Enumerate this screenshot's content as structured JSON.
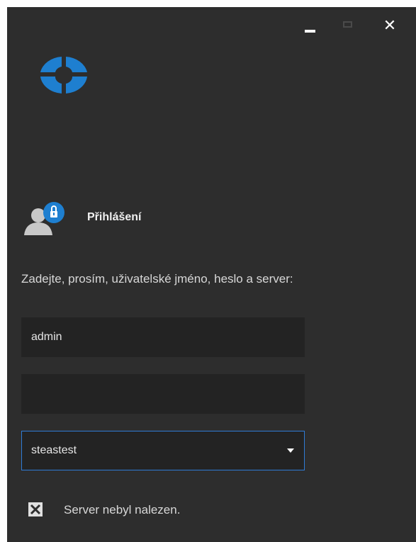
{
  "window": {
    "controls": {
      "close_glyph": "✕"
    }
  },
  "login": {
    "title": "Přihlášení",
    "instructions": "Zadejte, prosím, uživatelské jméno, heslo a server:",
    "username_value": "admin",
    "password_value": "",
    "server_value": "steastest"
  },
  "status": {
    "message": "Server nebyl nalezen."
  },
  "colors": {
    "background": "#2d2d2d",
    "field_background": "#232323",
    "accent_blue": "#1e7fd0",
    "focus_border": "#2f7bd6",
    "text": "#d8d8d8"
  },
  "icons": [
    "app-logo-icon",
    "user-lock-icon",
    "close-icon",
    "minimize-icon",
    "maximize-icon",
    "dropdown-arrow-icon",
    "error-x-icon"
  ]
}
